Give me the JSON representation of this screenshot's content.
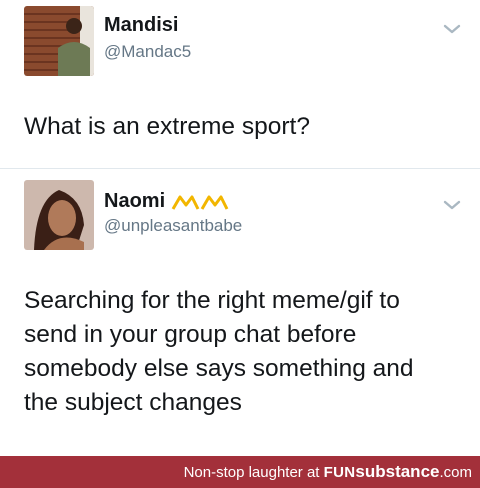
{
  "tweet1": {
    "name": "Mandisi",
    "handle": "@Mandac5",
    "text": "What is an extreme sport?"
  },
  "tweet2": {
    "name": "Naomi",
    "handle": "@unpleasantbabe",
    "text_lines": [
      "Searching for the right meme/gif to",
      "send in your group chat before",
      "somebody else says something and",
      "the subject changes"
    ]
  },
  "banner": {
    "prefix": "Non-stop laughter at ",
    "brand_bold": "FUN",
    "brand_rest": "substance",
    "suffix": ".com"
  },
  "colors": {
    "banner_bg": "#a3303a",
    "handle": "#657786",
    "text": "#14171a",
    "name_emoji": "#f2b600"
  },
  "icons": [
    "chevron-down-icon",
    "crown-emoji-icon"
  ]
}
